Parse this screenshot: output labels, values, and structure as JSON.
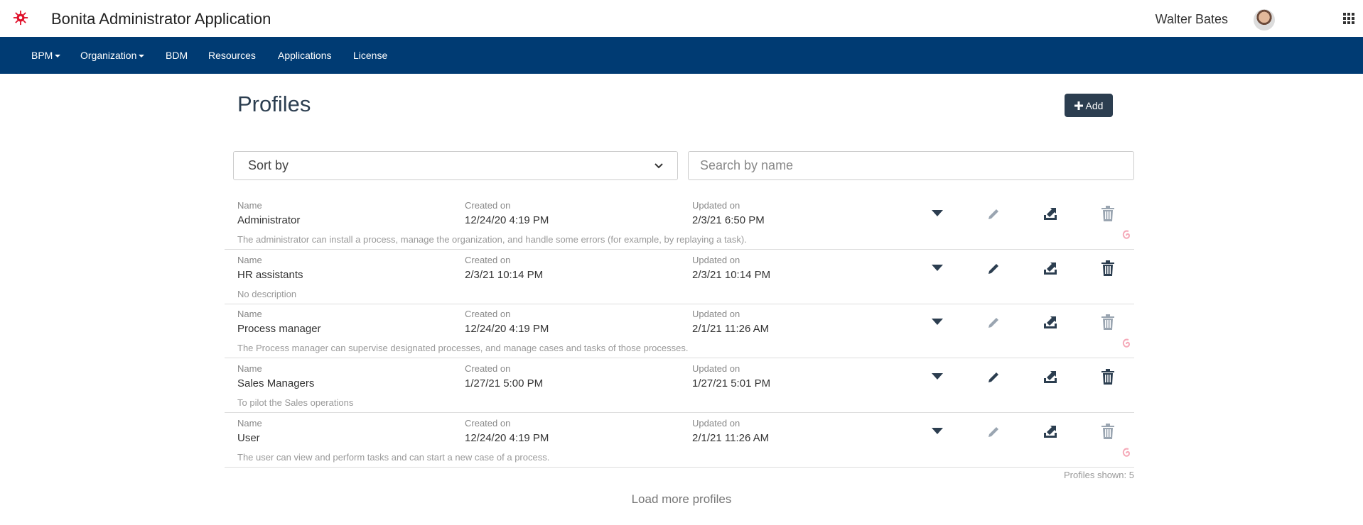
{
  "app": {
    "title": "Bonita Administrator Application",
    "user_name": "Walter Bates"
  },
  "nav": {
    "items": [
      {
        "label": "BPM",
        "dropdown": true
      },
      {
        "label": "Organization",
        "dropdown": true
      },
      {
        "label": "BDM",
        "dropdown": false
      },
      {
        "label": "Resources",
        "dropdown": false
      },
      {
        "label": "Applications",
        "dropdown": false
      },
      {
        "label": "License",
        "dropdown": false
      }
    ]
  },
  "page": {
    "title": "Profiles",
    "add_label": "Add",
    "sort_label": "Sort by",
    "search_placeholder": "Search by name",
    "col_labels": {
      "name": "Name",
      "created": "Created on",
      "updated": "Updated on"
    },
    "shown_text": "Profiles shown: 5",
    "load_more": "Load more profiles"
  },
  "profiles": [
    {
      "name": "Administrator",
      "created": "12/24/20 4:19 PM",
      "updated": "2/3/21 6:50 PM",
      "description": "The administrator can install a process, manage the organization, and handle some errors (for example, by replaying a task).",
      "editable": false
    },
    {
      "name": "HR assistants",
      "created": "2/3/21 10:14 PM",
      "updated": "2/3/21 10:14 PM",
      "description": "No description",
      "editable": true
    },
    {
      "name": "Process manager",
      "created": "12/24/20 4:19 PM",
      "updated": "2/1/21 11:26 AM",
      "description": "The Process manager can supervise designated processes, and manage cases and tasks of those processes.",
      "editable": false
    },
    {
      "name": "Sales Managers",
      "created": "1/27/21 5:00 PM",
      "updated": "1/27/21 5:01 PM",
      "description": "To pilot the Sales operations",
      "editable": true
    },
    {
      "name": "User",
      "created": "12/24/20 4:19 PM",
      "updated": "2/1/21 11:26 AM",
      "description": "The user can view and perform tasks and can start a new case of a process.",
      "editable": false
    }
  ],
  "colors": {
    "navbar": "#003b73",
    "primary_button": "#2c3e50",
    "logo": "#e0102a",
    "disabled_icon": "#9aa5b1",
    "active_icon": "#2c3e50",
    "provided_mark": "#f5a9b8"
  }
}
